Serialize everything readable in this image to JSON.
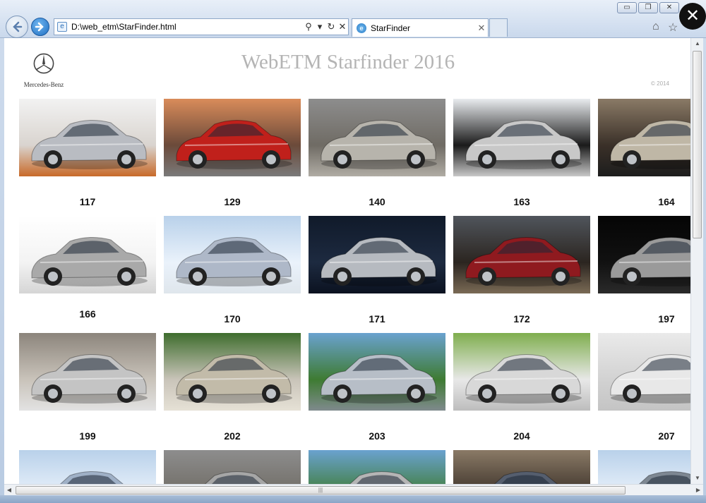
{
  "browser": {
    "address": "D:\\web_etm\\StarFinder.html",
    "tab_title": "StarFinder",
    "nav": {
      "back_icon": "back-arrow-icon",
      "forward_icon": "forward-arrow-icon"
    },
    "window_controls": {
      "minimize": "▭",
      "restore": "❐",
      "close": "✕"
    },
    "overlay_close": "✕"
  },
  "page": {
    "logo_text": "Mercedes-Benz",
    "title": "WebETM Starfinder 2016",
    "copyright": "© 2014"
  },
  "models": [
    {
      "code": "117",
      "scene": "studio-bright",
      "car_color": "#b9bcc2"
    },
    {
      "code": "129",
      "scene": "sunset",
      "car_color": "#c0201b"
    },
    {
      "code": "140",
      "scene": "street-grey",
      "car_color": "#b7b4ac"
    },
    {
      "code": "163",
      "scene": "dark-studio",
      "car_color": "#c8c8c8"
    },
    {
      "code": "164",
      "scene": "dusk",
      "car_color": "#bfb7a6"
    },
    {
      "code": "166",
      "scene": "white",
      "car_color": "#a9a9a9"
    },
    {
      "code": "170",
      "scene": "sky-blue",
      "car_color": "#aeb8c8"
    },
    {
      "code": "171",
      "scene": "dark-blue",
      "car_color": "#b6bac0"
    },
    {
      "code": "172",
      "scene": "night-road",
      "car_color": "#8f1a1f"
    },
    {
      "code": "197",
      "scene": "black",
      "car_color": "#9a9a9a"
    },
    {
      "code": "199",
      "scene": "rock",
      "car_color": "#c4c4c4"
    },
    {
      "code": "202",
      "scene": "garden",
      "car_color": "#c2bba9"
    },
    {
      "code": "203",
      "scene": "green-road",
      "car_color": "#b7bec7"
    },
    {
      "code": "204",
      "scene": "two-suv",
      "car_color": "#d8d8d8"
    },
    {
      "code": "207",
      "scene": "grey-studio",
      "car_color": "#e8e8e8"
    },
    {
      "code": "",
      "scene": "sky-blue",
      "car_color": "#9fb0c6"
    },
    {
      "code": "",
      "scene": "street-grey",
      "car_color": "#a6a6a6"
    },
    {
      "code": "",
      "scene": "green-road",
      "car_color": "#b5b5b5"
    },
    {
      "code": "",
      "scene": "dusk",
      "car_color": "#555e6e"
    },
    {
      "code": "",
      "scene": "sky-blue",
      "car_color": "#7d8792"
    }
  ]
}
